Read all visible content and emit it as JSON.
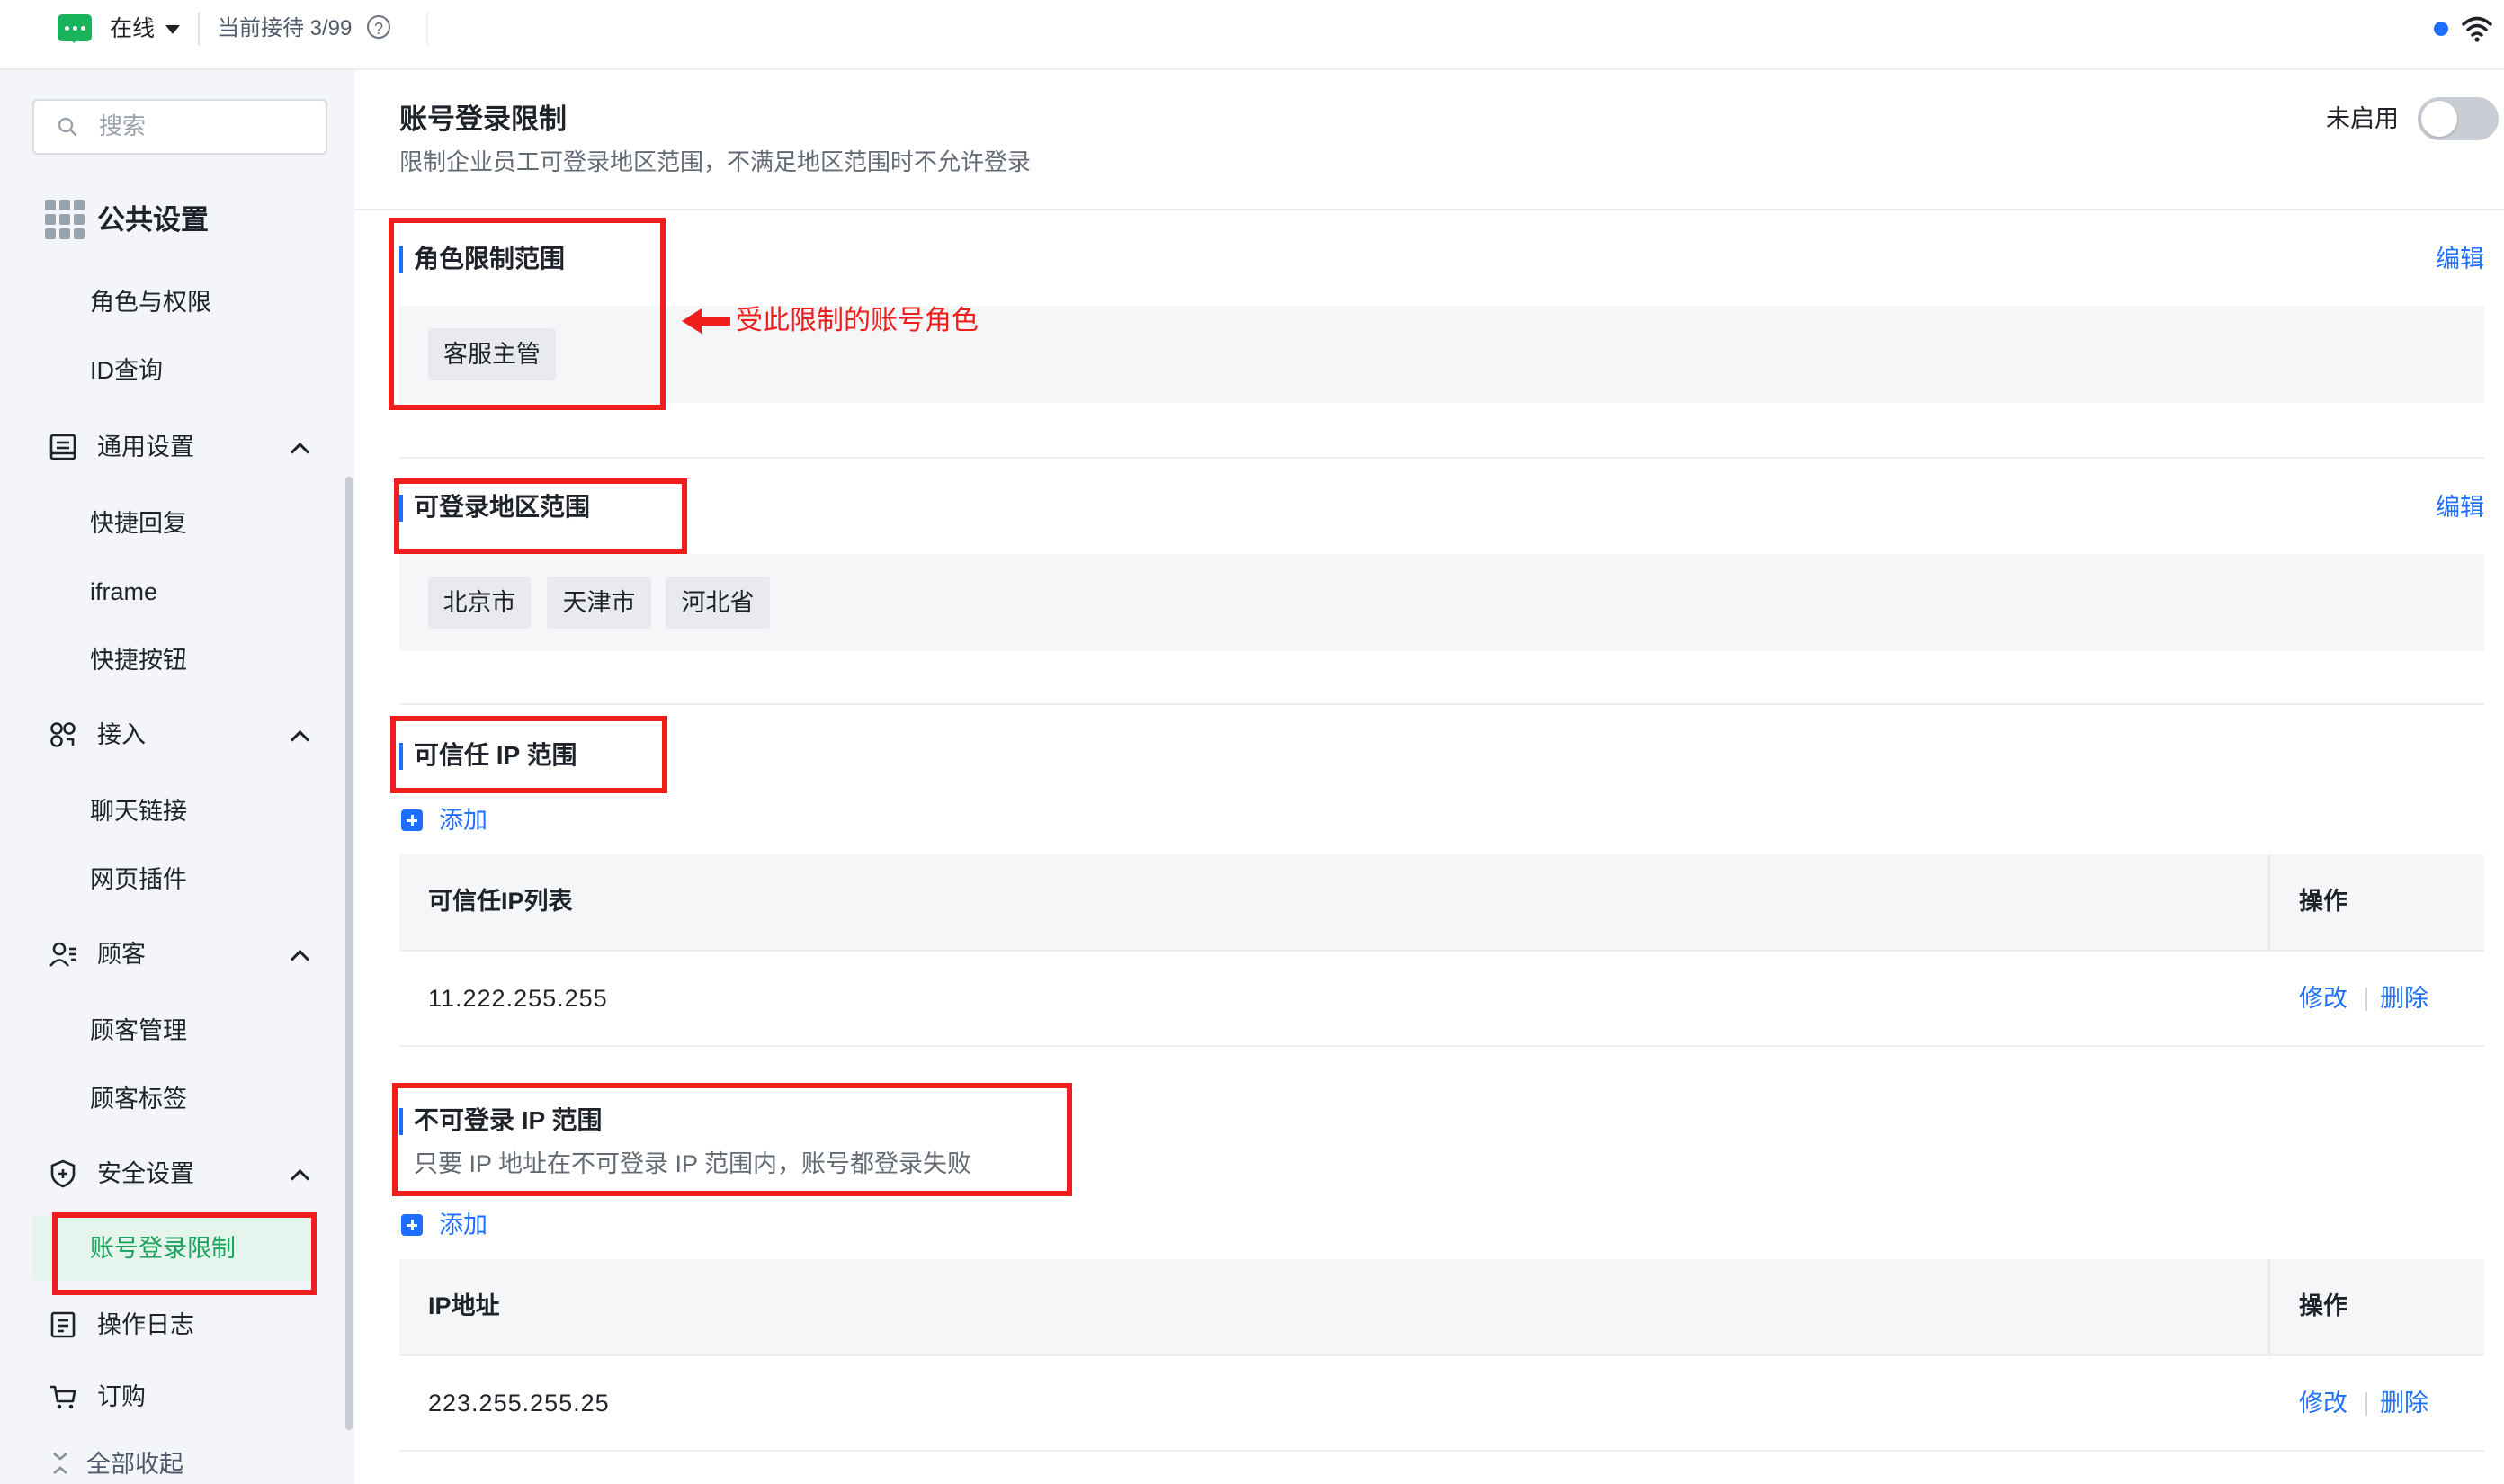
{
  "topbar": {
    "status_label": "在线",
    "reception_text": "当前接待 3/99",
    "help_icon": "question-circle-icon",
    "connection_dot_color": "#1e6fff",
    "wifi_icon": "wifi-icon"
  },
  "sidebar": {
    "search_placeholder": "搜索",
    "section_title": "公共设置",
    "items": {
      "roles": "角色与权限",
      "id_query": "ID查询",
      "general": "通用设置",
      "quick_reply": "快捷回复",
      "iframe": "iframe",
      "quick_button": "快捷按钮",
      "access": "接入",
      "chat_link": "聊天链接",
      "web_plugin": "网页插件",
      "customer": "顾客",
      "customer_mgmt": "顾客管理",
      "customer_tags": "顾客标签",
      "security": "安全设置",
      "login_limit": "账号登录限制",
      "op_log": "操作日志",
      "order": "订购"
    },
    "collapse_all": "全部收起"
  },
  "page": {
    "title": "账号登录限制",
    "description": "限制企业员工可登录地区范围，不满足地区范围时不允许登录",
    "toggle_label": "未启用",
    "toggle_enabled": false
  },
  "role_section": {
    "title": "角色限制范围",
    "edit": "编辑",
    "tags": [
      "客服主管"
    ],
    "annotation": "受此限制的账号角色"
  },
  "region_section": {
    "title": "可登录地区范围",
    "edit": "编辑",
    "tags": [
      "北京市",
      "天津市",
      "河北省"
    ]
  },
  "trusted_ip_section": {
    "title": "可信任 IP 范围",
    "add": "添加",
    "columns": [
      "可信任IP列表",
      "操作"
    ],
    "rows": [
      {
        "ip": "11.222.255.255",
        "edit": "修改",
        "delete": "删除"
      }
    ]
  },
  "blocked_ip_section": {
    "title": "不可登录 IP 范围",
    "description": "只要 IP 地址在不可登录 IP 范围内，账号都登录失败",
    "add": "添加",
    "columns": [
      "IP地址",
      "操作"
    ],
    "rows": [
      {
        "ip": "223.255.255.25",
        "edit": "修改",
        "delete": "删除"
      }
    ]
  },
  "colors": {
    "accent": "#1e6fff",
    "online": "#19b35c",
    "active_nav": "#19a35a",
    "annotation": "#f01d1d"
  }
}
